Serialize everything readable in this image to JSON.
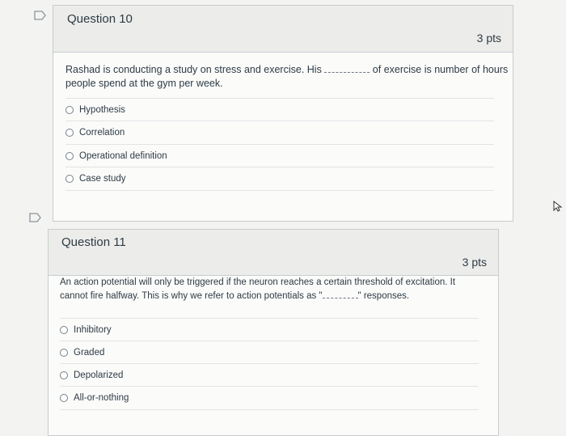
{
  "questions": [
    {
      "title": "Question 10",
      "points": "3 pts",
      "text_before": "Rashad is conducting a study on stress and exercise. His",
      "text_after": "of exercise is number of hours",
      "text_line2": "people spend at the gym per week.",
      "answers": [
        "Hypothesis",
        "Correlation",
        "Operational definition",
        "Case study"
      ]
    },
    {
      "title": "Question 11",
      "points": "3 pts",
      "text_line1": "An action potential will only be triggered if the neuron reaches a certain threshold of excitation. It",
      "text_line2_before": "cannot fire halfway. This is why we refer to action potentials as \"",
      "text_line2_after": "\" responses.",
      "answers": [
        "Inhibitory",
        "Graded",
        "Depolarized",
        "All-or-nothing"
      ]
    }
  ]
}
